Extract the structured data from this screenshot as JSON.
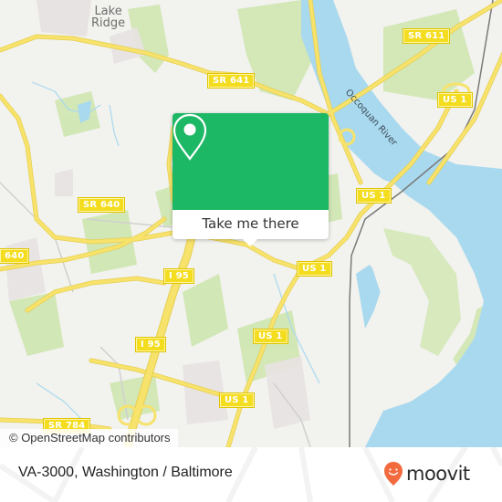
{
  "map": {
    "place_labels": [
      {
        "text": "Lake\nRidge",
        "line1": "Lake",
        "line2": "Ridge"
      }
    ],
    "river_label": "Occoquan River",
    "road_shields": [
      {
        "id": "sr611",
        "text": "SR 611"
      },
      {
        "id": "sr641",
        "text": "SR 641"
      },
      {
        "id": "us1_ne",
        "text": "US 1"
      },
      {
        "id": "sr640_mid",
        "text": "SR 640"
      },
      {
        "id": "us1_mid",
        "text": "US 1"
      },
      {
        "id": "sr640_left",
        "text": "640"
      },
      {
        "id": "i95_upper",
        "text": "I 95"
      },
      {
        "id": "us1_east",
        "text": "US 1"
      },
      {
        "id": "i95_lower",
        "text": "I 95"
      },
      {
        "id": "us1_south",
        "text": "US 1"
      },
      {
        "id": "us1_bottom",
        "text": "US 1"
      },
      {
        "id": "sr784",
        "text": "SR 784"
      }
    ],
    "attribution": "© OpenStreetMap contributors",
    "colors": {
      "land": "#f2f2ee",
      "park": "#cfe6b0",
      "water": "#a9d9ef",
      "road": "#f7e26b",
      "shield": "#f4dc1e"
    }
  },
  "popup": {
    "icon": "location-pin-icon",
    "button_label": "Take me there",
    "color": "#1db865"
  },
  "footer": {
    "title": "VA-3000, Washington / Baltimore",
    "brand": "moovit",
    "brand_color": "#f26a3d"
  }
}
